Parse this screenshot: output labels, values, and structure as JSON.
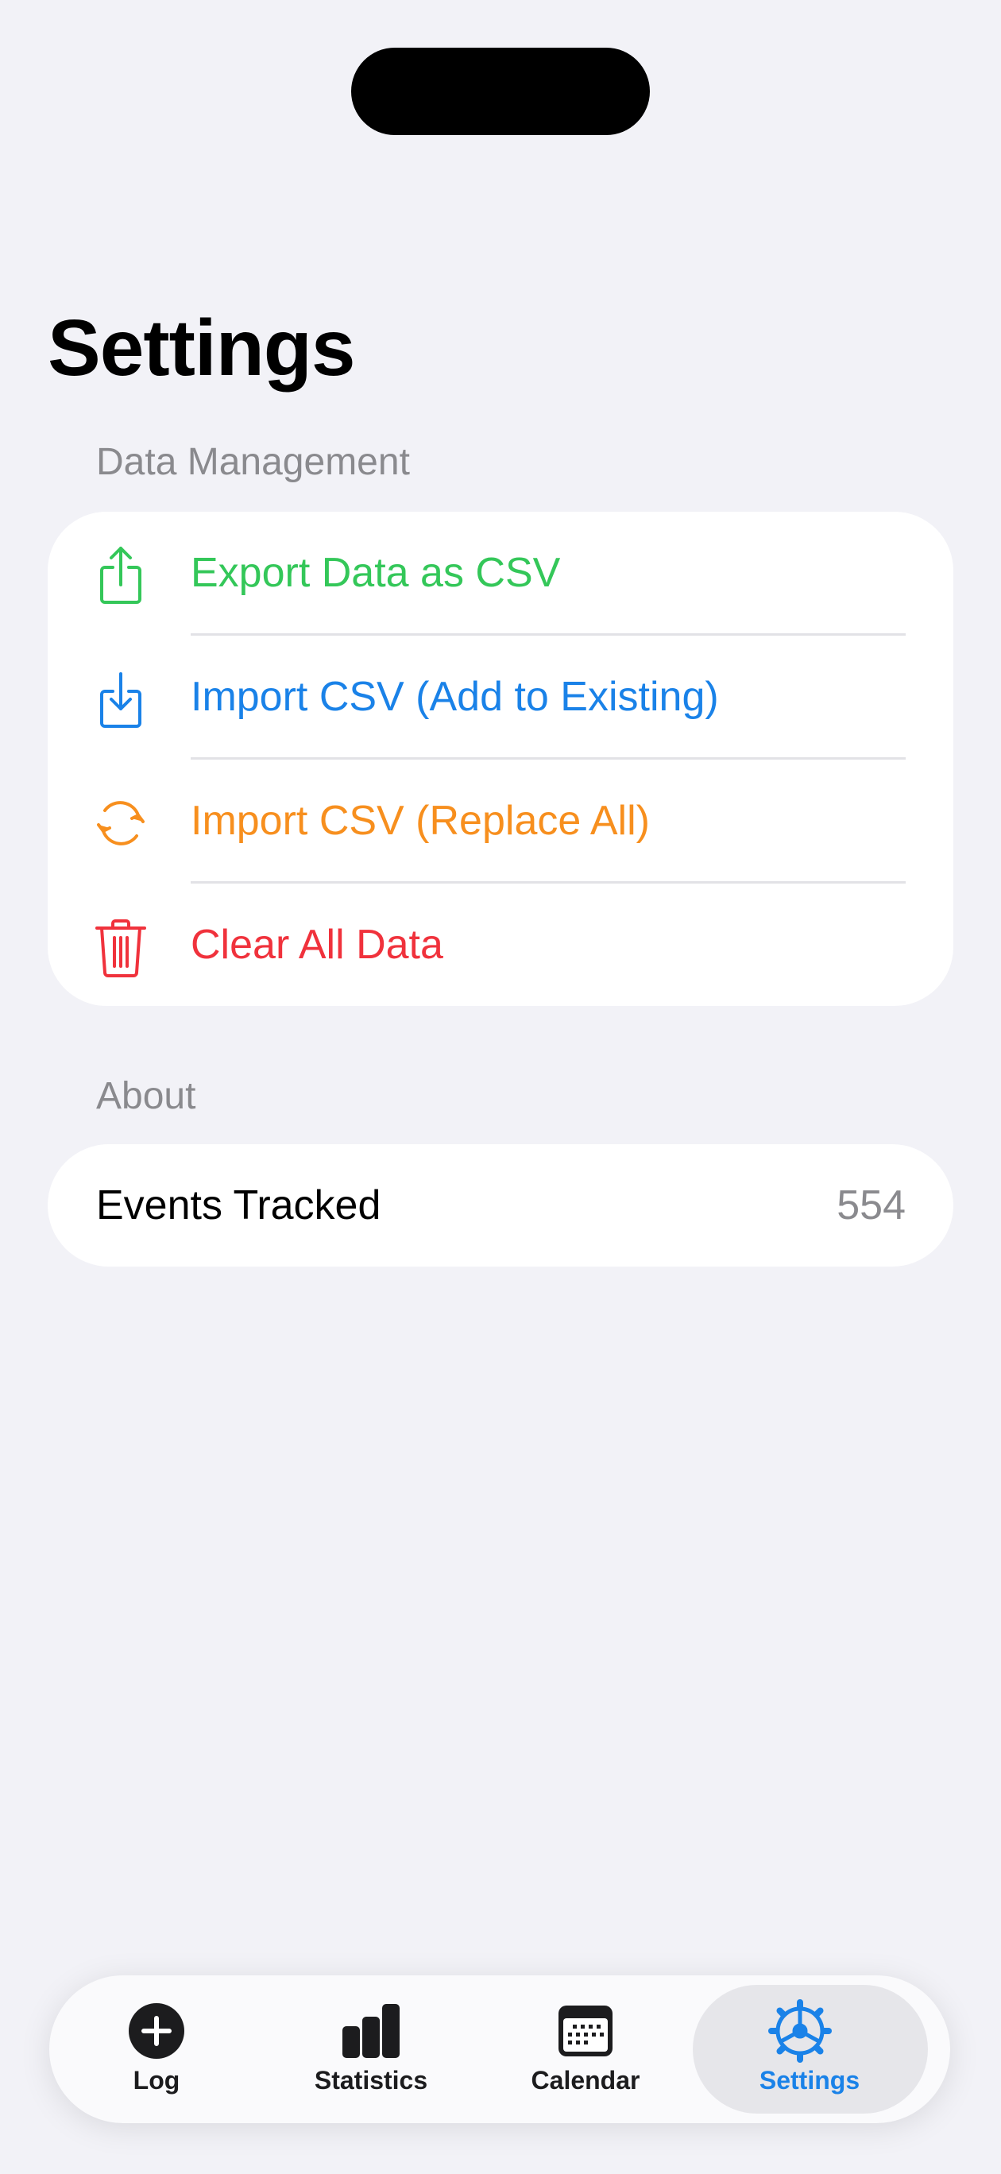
{
  "title": "Settings",
  "colors": {
    "green": "#34c759",
    "blue": "#1a82e8",
    "orange": "#f78f1e",
    "red": "#f0323c",
    "background": "#f2f2f7"
  },
  "sections": {
    "data_management": {
      "header": "Data Management",
      "items": [
        {
          "label": "Export Data as CSV",
          "icon": "share-icon",
          "color": "#34c759"
        },
        {
          "label": "Import CSV (Add to Existing)",
          "icon": "download-icon",
          "color": "#1a82e8"
        },
        {
          "label": "Import CSV (Replace All)",
          "icon": "refresh-icon",
          "color": "#f78f1e"
        },
        {
          "label": "Clear All Data",
          "icon": "trash-icon",
          "color": "#f0323c"
        }
      ]
    },
    "about": {
      "header": "About",
      "items": [
        {
          "label": "Events Tracked",
          "value": "554"
        }
      ]
    }
  },
  "tabbar": {
    "tabs": [
      {
        "label": "Log",
        "icon": "plus-circle-icon",
        "active": false
      },
      {
        "label": "Statistics",
        "icon": "bar-chart-icon",
        "active": false
      },
      {
        "label": "Calendar",
        "icon": "calendar-icon",
        "active": false
      },
      {
        "label": "Settings",
        "icon": "gear-icon",
        "active": true
      }
    ]
  }
}
